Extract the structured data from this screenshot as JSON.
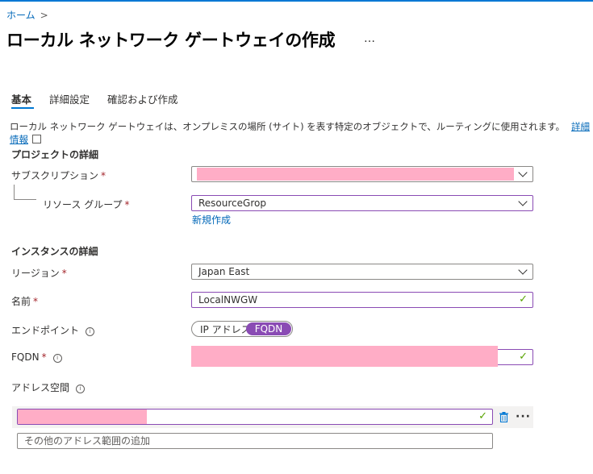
{
  "breadcrumb": {
    "home": "ホーム",
    "separator": ">"
  },
  "title": "ローカル ネットワーク ゲートウェイの作成",
  "title_more": "…",
  "tabs": [
    {
      "label": "基本",
      "active": true
    },
    {
      "label": "詳細設定",
      "active": false
    },
    {
      "label": "確認および作成",
      "active": false
    }
  ],
  "description": {
    "text": "ローカル ネットワーク ゲートウェイは、オンプレミスの場所 (サイト) を表す特定のオブジェクトで、ルーティングに使用されます。",
    "link": "詳細情報"
  },
  "project": {
    "heading": "プロジェクトの詳細",
    "subscription_label": "サブスクリプション",
    "subscription_value": "",
    "resource_group_label": "リソース グループ",
    "resource_group_value": "ResourceGrop",
    "create_new": "新規作成"
  },
  "instance": {
    "heading": "インスタンスの詳細",
    "region_label": "リージョン",
    "region_value": "Japan East",
    "name_label": "名前",
    "name_value": "LocalNWGW",
    "endpoint_label": "エンドポイント",
    "endpoint_options": [
      "IP アドレス",
      "FQDN"
    ],
    "endpoint_selected": "FQDN",
    "fqdn_label": "FQDN",
    "fqdn_value": "",
    "address_space_label": "アドレス空間",
    "address_value": "",
    "address_placeholder": "その他のアドレス範囲の追加"
  },
  "required_marker": "*",
  "colors": {
    "accent": "#0078d4",
    "link": "#0067b8",
    "toggle": "#8a4bb4",
    "valid": "#57a300",
    "required": "#a4262c"
  }
}
